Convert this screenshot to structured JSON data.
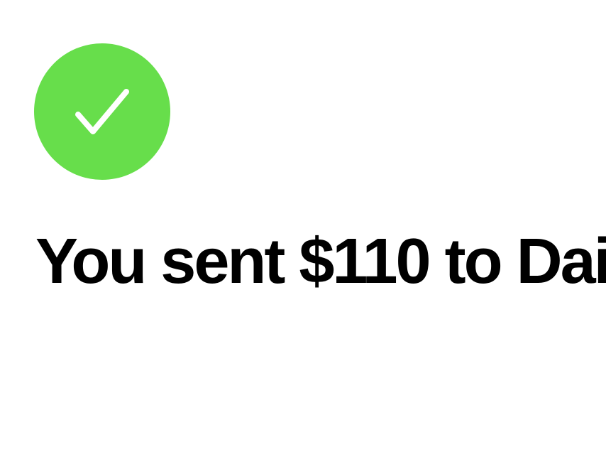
{
  "confirmation": {
    "status_icon": "check-icon",
    "headline": "You sent $110 to Dai"
  },
  "colors": {
    "success_green": "#67DE4B",
    "check_mark": "#FFFFFF",
    "headline_text": "#000000",
    "background": "#FFFFFF"
  }
}
